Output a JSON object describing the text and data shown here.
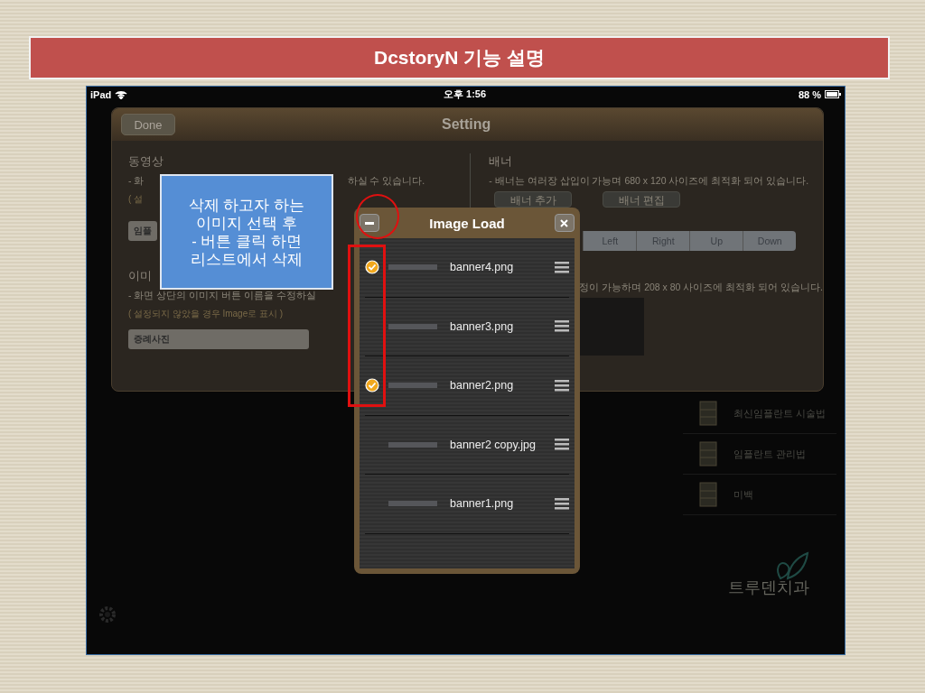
{
  "slide": {
    "title": "DcstoryN 기능 설명"
  },
  "status_bar": {
    "device": "iPad",
    "time": "오후 1:56",
    "battery": "88 %"
  },
  "sidebar": {
    "items": [
      "최신임플란트 시술법",
      "임플란트 관리법",
      "미백"
    ],
    "logo": "트루덴치과"
  },
  "settings": {
    "title": "Setting",
    "done_button": "Done",
    "video": {
      "heading": "동영상",
      "line_start": "- 화",
      "line_end": "하실 수 있습니다.",
      "note": "( 설",
      "field": "임플"
    },
    "image": {
      "heading": "이미",
      "line": "- 화면 상단의 이미지 버튼 이름을 수정하실",
      "note": "( 설정되지 않았을 경우 Image로 표시 )",
      "field": "증례사진"
    },
    "banner": {
      "heading": "배너",
      "line": "- 배너는 여러장 삽입이 가능며 680 x 120 사이즈에 최적화 되어 있습니다.",
      "buttons": [
        "배너 추가",
        "배너 편집"
      ],
      "segments": [
        "Left",
        "Right",
        "Up",
        "Down"
      ],
      "logo_line": "정이 가능하며 208 x 80 사이즈에 최적화 되어 있습니다."
    }
  },
  "popup": {
    "title": "Image Load",
    "rows": [
      {
        "name": "banner4.png",
        "checked": true
      },
      {
        "name": "banner3.png",
        "checked": false
      },
      {
        "name": "banner2.png",
        "checked": true
      },
      {
        "name": "banner2 copy.jpg",
        "checked": false
      },
      {
        "name": "banner1.png",
        "checked": false
      }
    ]
  },
  "callout": {
    "text": "삭제 하고자 하는\n이미지 선택 후\n- 버튼 클릭 하면\n리스트에서 삭제"
  }
}
